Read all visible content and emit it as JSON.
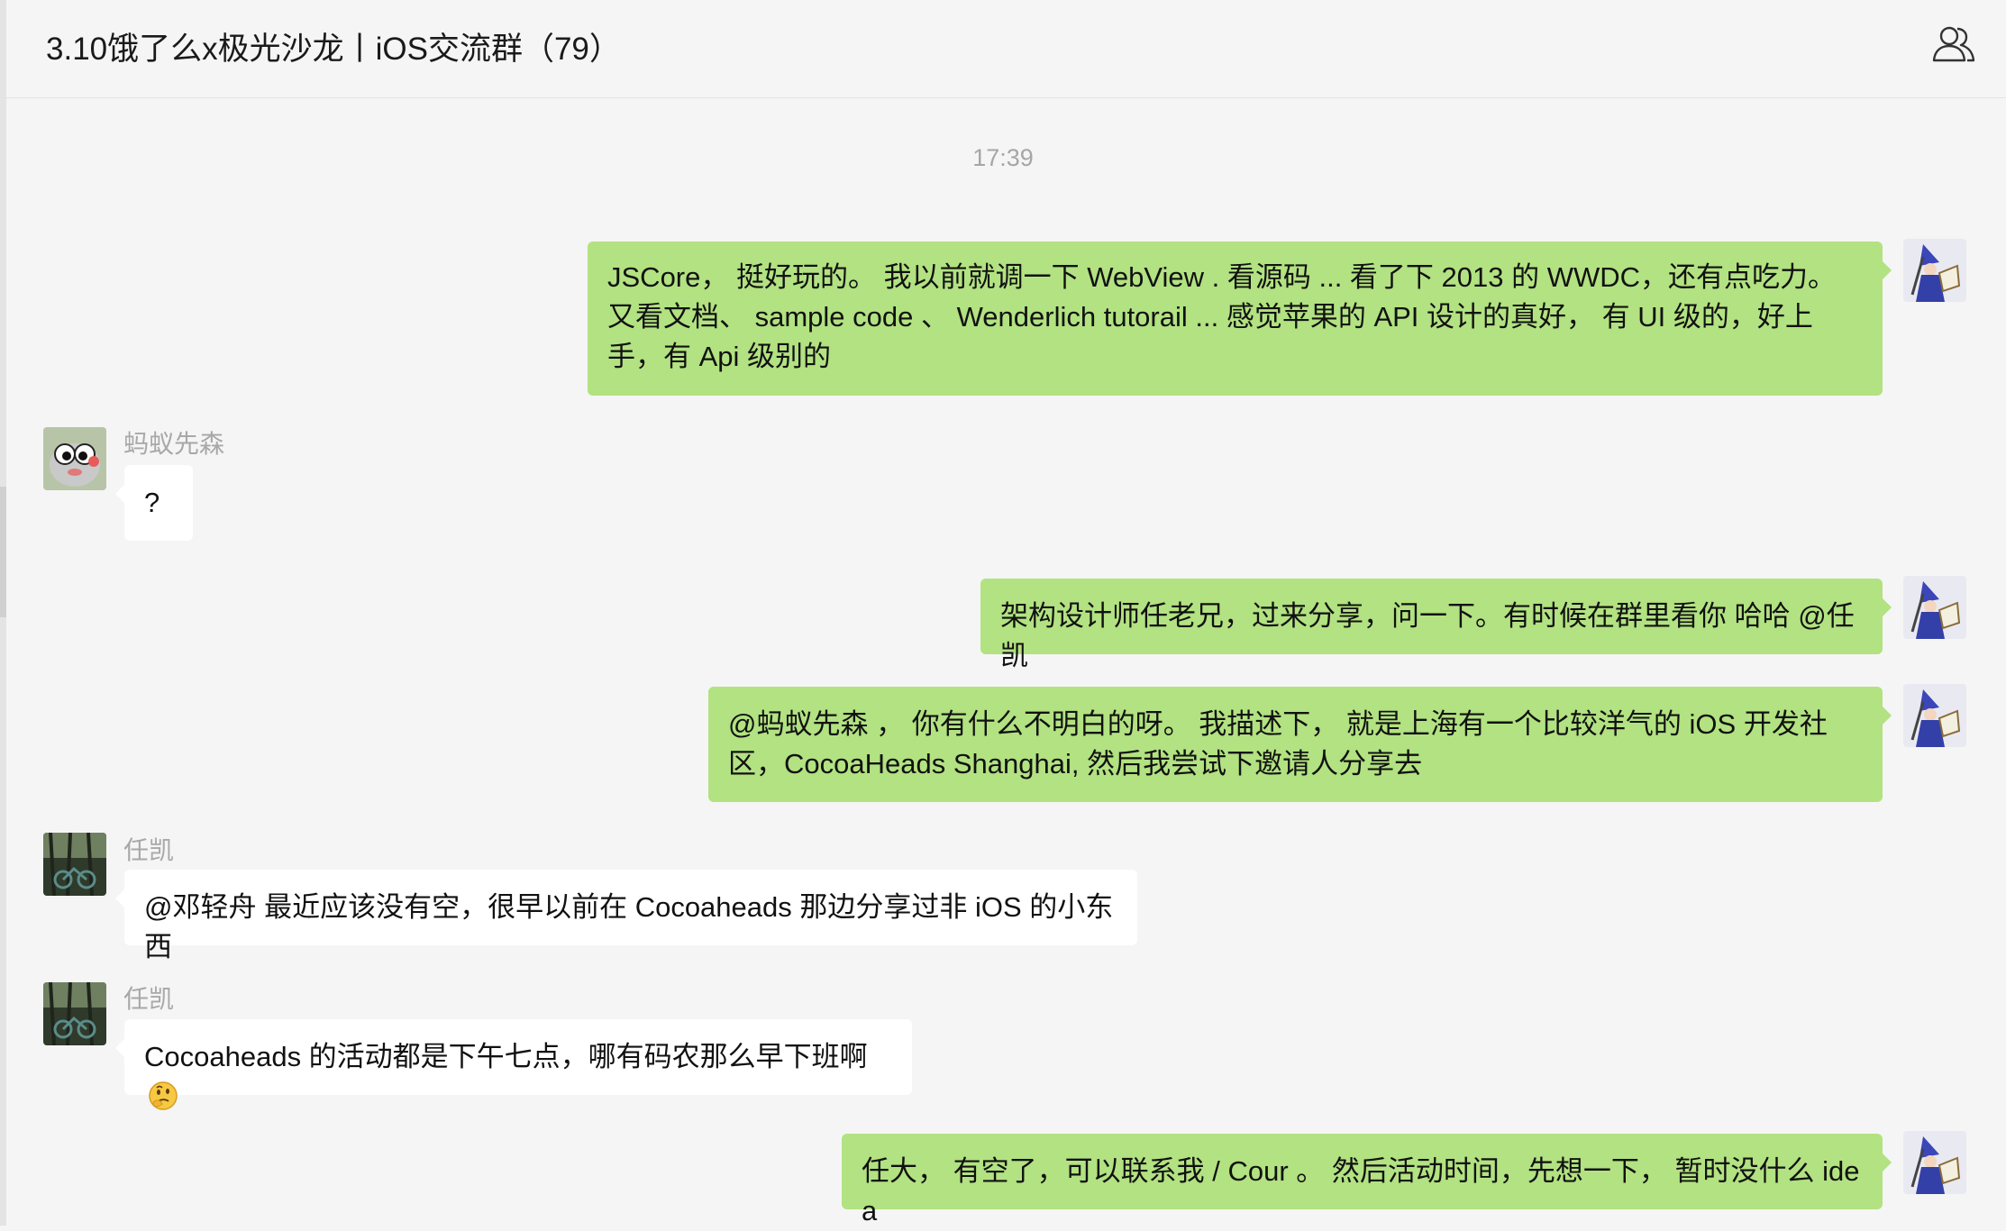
{
  "chat": {
    "title": "3.10饿了么x极光沙龙丨iOS交流群（79）",
    "timestamp": "17:39"
  },
  "icons": {
    "members": "members-icon",
    "emoji": "thinking-face-icon"
  },
  "colors": {
    "outgoing_bubble": "#b2e281",
    "incoming_bubble": "#ffffff",
    "background": "#f5f5f5"
  },
  "messages": [
    {
      "side": "right",
      "text": "JSCore， 挺好玩的。 我以前就调一下 WebView . 看源码 ... 看了下 2013 的 WWDC，还有点吃力。 又看文档、 sample code 、 Wenderlich tutorail ... 感觉苹果的 API 设计的真好， 有 UI 级的，好上手，有 Api 级别的"
    },
    {
      "side": "left",
      "sender": "蚂蚁先森",
      "text": "?"
    },
    {
      "side": "right",
      "text": "架构设计师任老兄，过来分享，问一下。有时候在群里看你 哈哈 @任凯"
    },
    {
      "side": "right",
      "text": "@蚂蚁先森 ， 你有什么不明白的呀。 我描述下， 就是上海有一个比较洋气的 iOS 开发社区，CocoaHeads Shanghai, 然后我尝试下邀请人分享去"
    },
    {
      "side": "left",
      "sender": "任凯",
      "text": "@邓轻舟 最近应该没有空，很早以前在 Cocoaheads 那边分享过非 iOS 的小东西"
    },
    {
      "side": "left",
      "sender": "任凯",
      "text": "Cocoaheads 的活动都是下午七点，哪有码农那么早下班啊"
    },
    {
      "side": "right",
      "text": "任大， 有空了，可以联系我 / Cour 。 然后活动时间，先想一下， 暂时没什么 idea"
    }
  ]
}
